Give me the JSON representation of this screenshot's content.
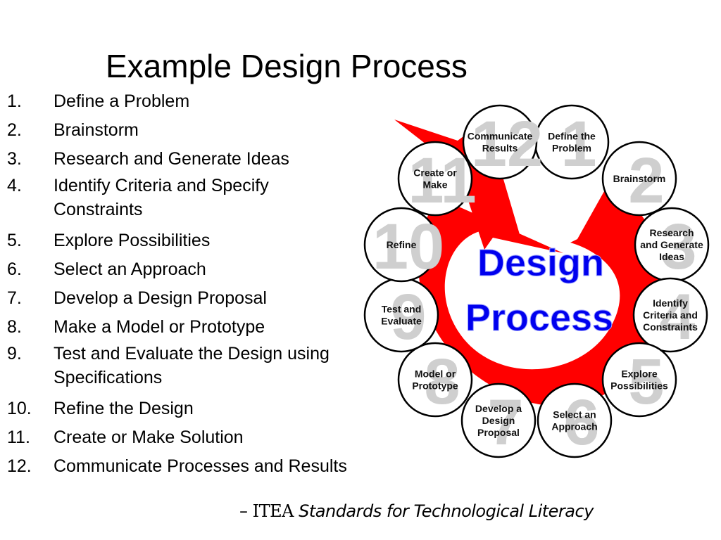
{
  "slide": {
    "title": "Example Design Process",
    "steps": [
      {
        "num": "1.",
        "text": "Define a Problem"
      },
      {
        "num": "2.",
        "text": "Brainstorm"
      },
      {
        "num": "3.",
        "text": "Research and Generate Ideas"
      },
      {
        "num": "4.",
        "text": "Identify Criteria and Specify",
        "text2": "Constraints"
      },
      {
        "num": "5.",
        "text": "Explore Possibilities"
      },
      {
        "num": "6.",
        "text": "Select an Approach"
      },
      {
        "num": "7.",
        "text": "Develop a Design Proposal"
      },
      {
        "num": "8.",
        "text": "Make a Model or Prototype"
      },
      {
        "num": "9.",
        "text": "Test and Evaluate the Design using",
        "text2": "Specifications"
      },
      {
        "num": "10.",
        "text": "Refine the Design"
      },
      {
        "num": "11.",
        "text": "Create or Make Solution"
      },
      {
        "num": "12.",
        "text": "Communicate Processes and Results"
      }
    ],
    "citation": {
      "dash": "– ",
      "org": "ITEA",
      "work": "Standards for Technological Literacy"
    }
  },
  "diagram": {
    "center_title_line1": "Design",
    "center_title_line2": "Process",
    "colors": {
      "arrow": "#ff0000",
      "center_text": "#0000ee",
      "big_number": "#cfcfcf",
      "circle_fill": "#ffffff",
      "circle_stroke": "#000000"
    },
    "stages": [
      {
        "n": "1",
        "lines": [
          "Define the",
          "Problem"
        ]
      },
      {
        "n": "2",
        "lines": [
          "Brainstorm"
        ]
      },
      {
        "n": "3",
        "lines": [
          "Research",
          "and Generate",
          "Ideas"
        ]
      },
      {
        "n": "4",
        "lines": [
          "Identify",
          "Criteria and",
          "Constraints"
        ]
      },
      {
        "n": "5",
        "lines": [
          "Explore",
          "Possibilities"
        ]
      },
      {
        "n": "6",
        "lines": [
          "Select an",
          "Approach"
        ]
      },
      {
        "n": "7",
        "lines": [
          "Develop a",
          "Design",
          "Proposal"
        ]
      },
      {
        "n": "8",
        "lines": [
          "Model or",
          "Prototype"
        ]
      },
      {
        "n": "9",
        "lines": [
          "Test and",
          "Evaluate"
        ]
      },
      {
        "n": "10",
        "lines": [
          "Refine"
        ]
      },
      {
        "n": "11",
        "lines": [
          "Create or",
          "Make"
        ]
      },
      {
        "n": "12",
        "lines": [
          "Communicate",
          "Results"
        ]
      }
    ]
  }
}
